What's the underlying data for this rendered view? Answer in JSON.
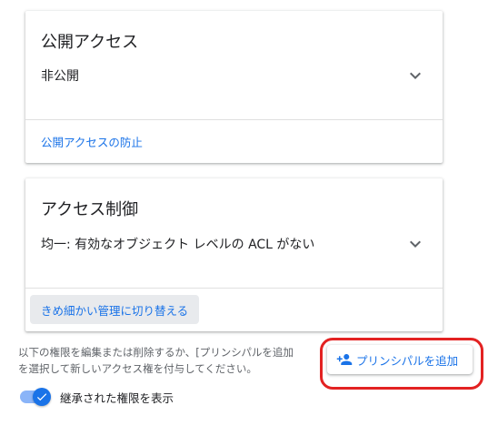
{
  "public_access_card": {
    "title": "公開アクセス",
    "value": "非公開",
    "link": "公開アクセスの防止"
  },
  "access_control_card": {
    "title": "アクセス制御",
    "value": "均一: 有効なオブジェクト レベルの ACL がない",
    "button": "きめ細かい管理に切り替える"
  },
  "permissions": {
    "info_line1": "以下の権限を編集または削除するか、[プリンシパルを追加",
    "info_line2": "を選択して新しいアクセス権を付与してください。",
    "add_principal_button": "プリンシパルを追加",
    "add_principal_icon": "person-add-icon",
    "toggle_label": "継承された権限を表示",
    "toggle_on": true
  },
  "colors": {
    "accent": "#1a73e8",
    "highlight": "#e32222"
  }
}
